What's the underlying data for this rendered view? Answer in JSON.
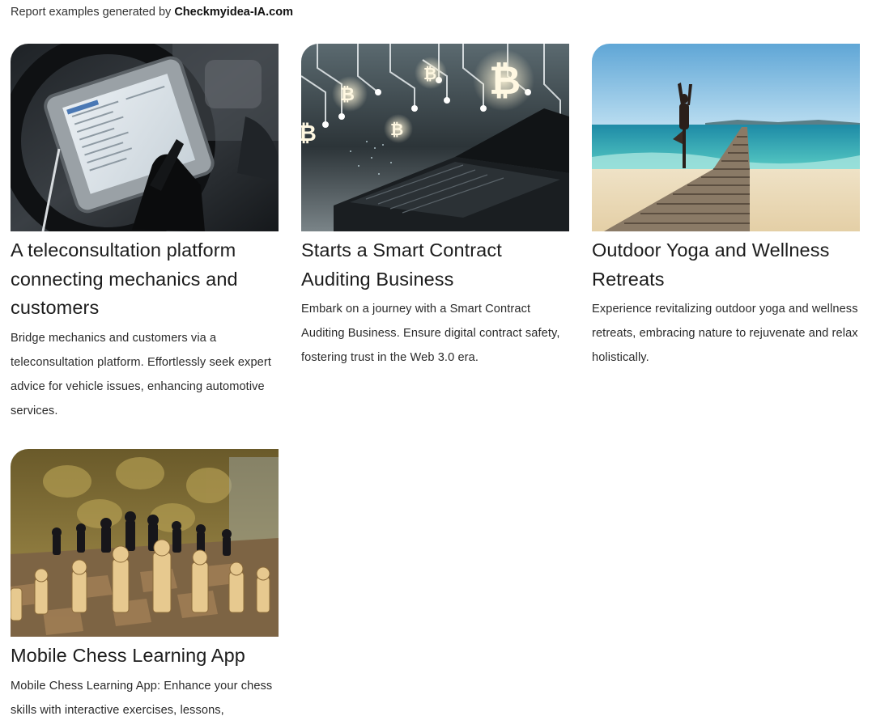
{
  "header": {
    "prefix": "Report examples generated by ",
    "brand": "Checkmyidea-IA.com"
  },
  "cards": [
    {
      "image": "mechanic-diagnostic-tablet-photo",
      "title": "A teleconsultation platform connecting mechanics and customers",
      "description": "Bridge mechanics and customers via a teleconsultation platform. Effortlessly seek expert advice for vehicle issues, enhancing automotive services."
    },
    {
      "image": "bitcoin-circuit-laptop-photo",
      "title": "Starts a Smart Contract Auditing Business",
      "description": "Embark on a journey with a Smart Contract Auditing Business. Ensure digital contract safety, fostering trust in the Web 3.0 era."
    },
    {
      "image": "yoga-pier-beach-photo",
      "title": "Outdoor Yoga and Wellness Retreats",
      "description": "Experience revitalizing outdoor yoga and wellness retreats, embracing nature to rejuvenate and relax holistically."
    },
    {
      "image": "chess-board-photo",
      "title": "Mobile Chess Learning App",
      "description": "Mobile Chess Learning App: Enhance your chess skills with interactive exercises, lessons,"
    }
  ]
}
